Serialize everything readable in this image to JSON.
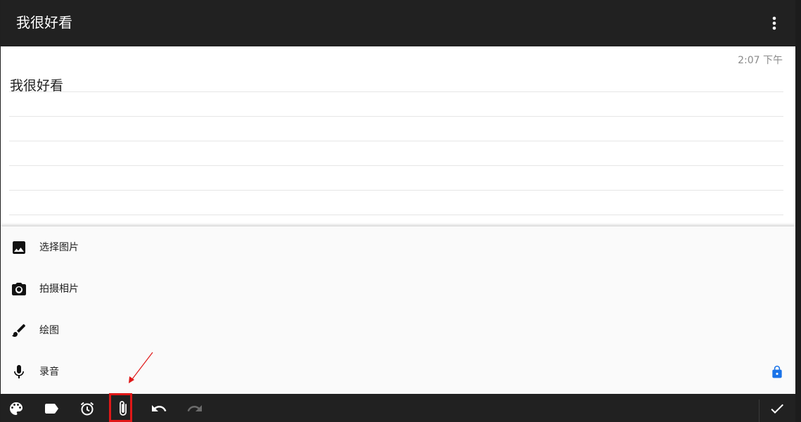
{
  "app_bar": {
    "title": "我很好看",
    "menu_icon": "more-vertical-icon"
  },
  "note": {
    "timestamp": "2:07 下午",
    "text": "我很好看"
  },
  "attach_menu": {
    "items": [
      {
        "label": "选择图片",
        "icon": "image-icon"
      },
      {
        "label": "拍摄相片",
        "icon": "camera-icon"
      },
      {
        "label": "绘图",
        "icon": "brush-icon"
      },
      {
        "label": "录音",
        "icon": "microphone-icon"
      }
    ],
    "lock_icon": "lock-icon",
    "lock_color": "#1a73e8"
  },
  "toolbar": {
    "icons": [
      "palette-icon",
      "label-icon",
      "alarm-icon",
      "attach-icon",
      "undo-icon",
      "redo-icon",
      "check-icon"
    ],
    "highlighted": "attach-icon"
  },
  "colors": {
    "bar": "#212121",
    "annotation": "#e01818"
  }
}
